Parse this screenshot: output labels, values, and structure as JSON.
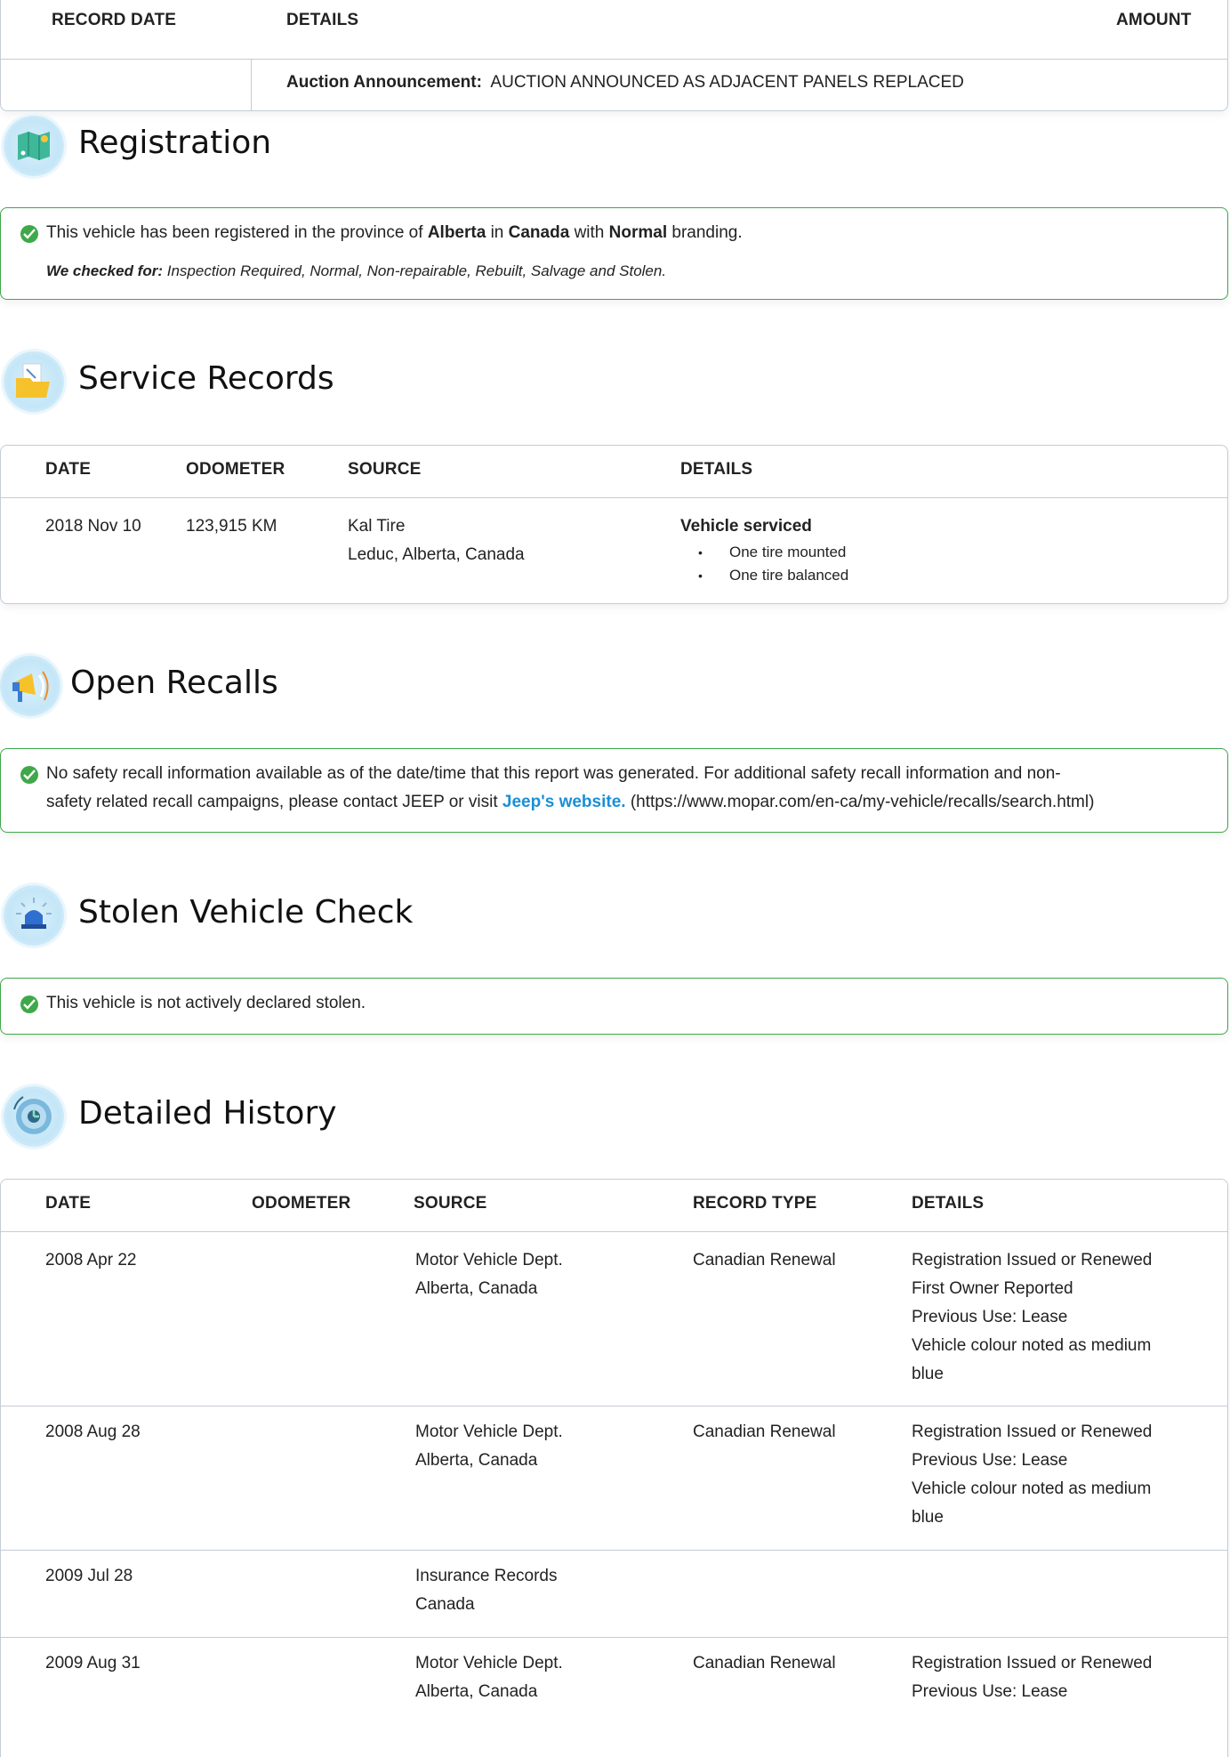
{
  "auction_table": {
    "headers": [
      "RECORD DATE",
      "DETAILS",
      "AMOUNT"
    ],
    "row": {
      "label": "Auction Announcement:",
      "text": "AUCTION ANNOUNCED AS ADJACENT PANELS REPLACED"
    }
  },
  "registration": {
    "title": "Registration",
    "line_prefix": "This vehicle has been registered in the province of",
    "province": "Alberta",
    "in_word": "in",
    "country": "Canada",
    "with_word": "with",
    "branding": "Normal",
    "line_suffix": "branding.",
    "checked_label": "We checked for:",
    "checked_list": "Inspection Required, Normal, Non-repairable, Rebuilt, Salvage and Stolen."
  },
  "service_records": {
    "title": "Service Records",
    "headers": [
      "DATE",
      "ODOMETER",
      "SOURCE",
      "DETAILS"
    ],
    "row": {
      "date": "2018 Nov 10",
      "odometer": "123,915 KM",
      "source_line1": "Kal Tire",
      "source_line2": "Leduc, Alberta, Canada",
      "detail_title": "Vehicle serviced",
      "detail_items": [
        "One tire mounted",
        "One tire balanced"
      ]
    }
  },
  "open_recalls": {
    "title": "Open Recalls",
    "text_line1": "No safety recall information available as of the date/time that this report was generated. For additional safety recall information and non-",
    "text_line2_prefix": "safety related recall campaigns, please contact JEEP or visit",
    "link_text": "Jeep's website.",
    "url_text": "(https://www.mopar.com/en-ca/my-vehicle/recalls/search.html)"
  },
  "stolen_check": {
    "title": "Stolen Vehicle Check",
    "text": "This vehicle is not actively declared stolen."
  },
  "detailed_history": {
    "title": "Detailed History",
    "headers": [
      "DATE",
      "ODOMETER",
      "SOURCE",
      "RECORD TYPE",
      "DETAILS"
    ],
    "rows": [
      {
        "date": "2008 Apr 22",
        "source1": "Motor Vehicle Dept.",
        "source2": "Alberta, Canada",
        "type": "Canadian Renewal",
        "details": [
          "Registration Issued or Renewed",
          "First Owner Reported",
          "Previous Use: Lease",
          "Vehicle colour noted as medium",
          "blue"
        ]
      },
      {
        "date": "2008 Aug 28",
        "source1": "Motor Vehicle Dept.",
        "source2": "Alberta, Canada",
        "type": "Canadian Renewal",
        "details": [
          "Registration Issued or Renewed",
          "Previous Use: Lease",
          "Vehicle colour noted as medium",
          "blue"
        ]
      },
      {
        "date": "2009 Jul 28",
        "source1": "Insurance Records",
        "source2": "Canada",
        "type": "",
        "details": []
      },
      {
        "date": "2009 Aug 31",
        "source1": "Motor Vehicle Dept.",
        "source2": "Alberta, Canada",
        "type": "Canadian Renewal",
        "details": [
          "Registration Issued or Renewed",
          "Previous Use: Lease"
        ]
      }
    ]
  }
}
